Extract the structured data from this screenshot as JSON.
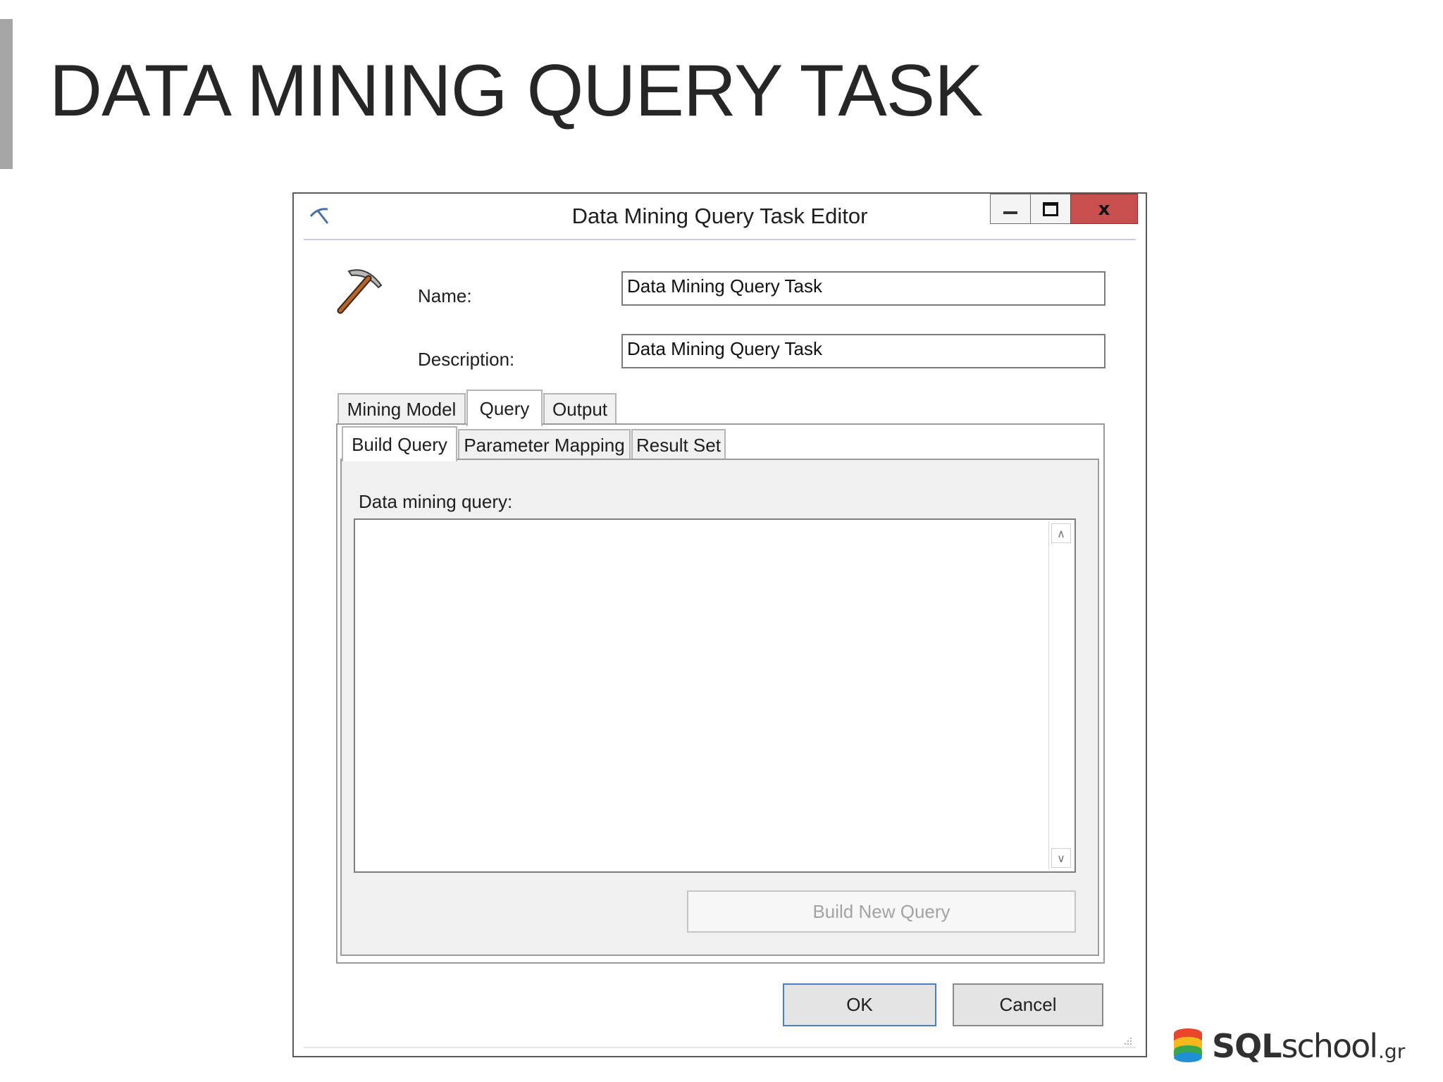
{
  "slide": {
    "title": "DATA MINING QUERY TASK"
  },
  "dialog": {
    "title": "Data Mining Query Task Editor",
    "controls": {
      "minimize": "minimize-icon",
      "maximize": "maximize-icon",
      "close_label": "x"
    },
    "icon": "pickaxe-icon",
    "name_label": "Name:",
    "name_value": "Data Mining Query Task",
    "description_label": "Description:",
    "description_value": "Data Mining Query Task",
    "tabs": [
      {
        "label": "Mining Model",
        "active": false
      },
      {
        "label": "Query",
        "active": true
      },
      {
        "label": "Output",
        "active": false
      }
    ],
    "subtabs": [
      {
        "label": "Build Query",
        "active": true
      },
      {
        "label": "Parameter Mapping",
        "active": false
      },
      {
        "label": "Result Set",
        "active": false
      }
    ],
    "query_label": "Data mining query:",
    "query_value": "",
    "build_new_query_label": "Build New Query",
    "ok_label": "OK",
    "cancel_label": "Cancel"
  },
  "logo": {
    "sql": "SQL",
    "school": "school",
    "tld": ".gr",
    "colors": [
      "#e8452c",
      "#f6b81a",
      "#3aa64a",
      "#1f8fd6"
    ]
  }
}
